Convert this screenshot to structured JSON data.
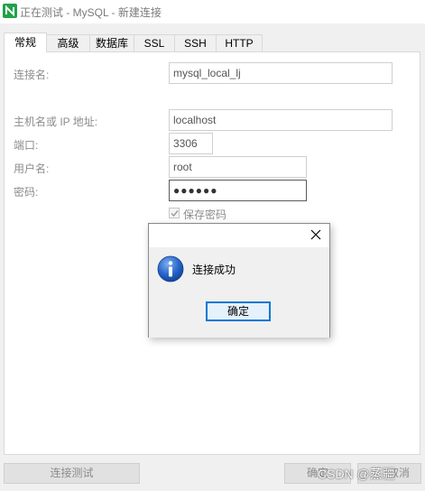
{
  "window": {
    "title": "正在测试 - MySQL - 新建连接"
  },
  "tabs": [
    {
      "label": "常规",
      "active": true
    },
    {
      "label": "高级",
      "active": false
    },
    {
      "label": "数据库",
      "active": false
    },
    {
      "label": "SSL",
      "active": false
    },
    {
      "label": "SSH",
      "active": false
    },
    {
      "label": "HTTP",
      "active": false
    }
  ],
  "form": {
    "connection_name": {
      "label": "连接名:",
      "value": "mysql_local_lj"
    },
    "host": {
      "label": "主机名或 IP 地址:",
      "value": "localhost"
    },
    "port": {
      "label": "端口:",
      "value": "3306"
    },
    "username": {
      "label": "用户名:",
      "value": "root"
    },
    "password": {
      "label": "密码:",
      "value": "●●●●●●"
    },
    "save_password": {
      "label": "保存密码",
      "checked": true
    }
  },
  "bottom_buttons": {
    "test_connection": "连接测试",
    "ok": "确定",
    "cancel": "取消"
  },
  "watermark": "CSDN @蒸疆",
  "dialog": {
    "message": "连接成功",
    "ok_label": "确定",
    "icon": "info-icon"
  },
  "colors": {
    "app_icon": "#21a24a",
    "info_icon": "#1f5fbf",
    "focus_border": "#0078d7"
  }
}
